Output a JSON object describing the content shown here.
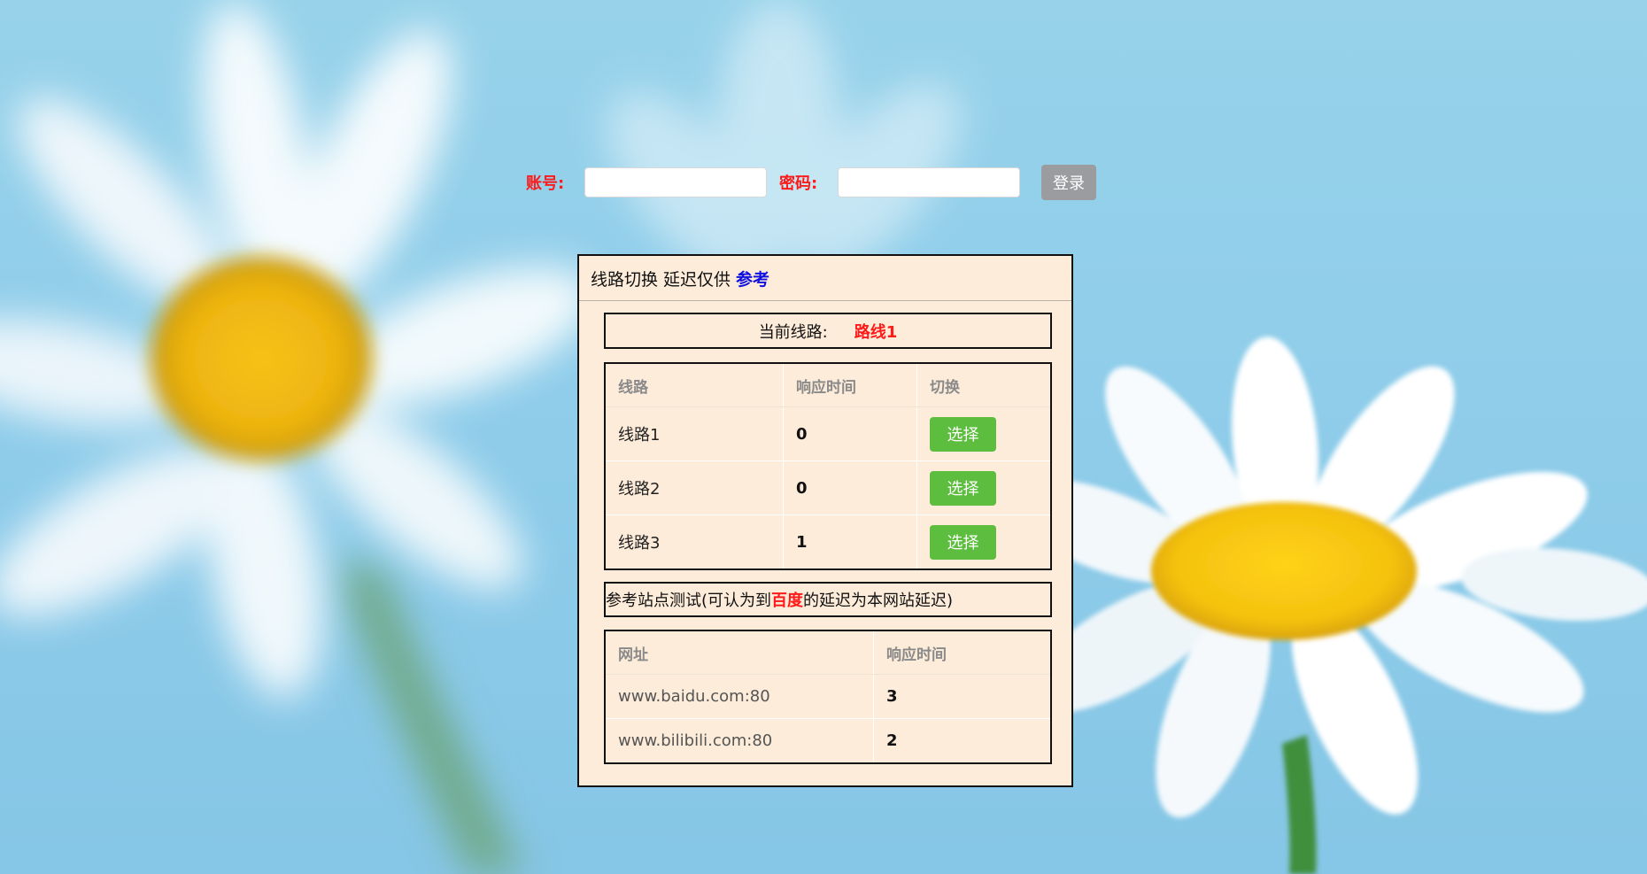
{
  "login": {
    "account_label": "账号:",
    "password_label": "密码:",
    "account_value": "",
    "password_value": "",
    "login_button": "登录"
  },
  "panel": {
    "title": "线路切换 延迟仅供",
    "title_highlight": "参考",
    "current_route_label": "当前线路:",
    "current_route_value": "路线1",
    "routes_table": {
      "headers": [
        "线路",
        "响应时间",
        "切换"
      ],
      "rows": [
        {
          "name": "线路1",
          "latency": "0",
          "action": "选择"
        },
        {
          "name": "线路2",
          "latency": "0",
          "action": "选择"
        },
        {
          "name": "线路3",
          "latency": "1",
          "action": "选择"
        }
      ]
    },
    "ref_test": {
      "prefix": "参考站点测试(可认为到",
      "highlight": "百度",
      "suffix": "的延迟为本网站延迟)"
    },
    "sites_table": {
      "headers": [
        "网址",
        "响应时间"
      ],
      "rows": [
        {
          "url": "www.baidu.com:80",
          "latency": "3"
        },
        {
          "url": "www.bilibili.com:80",
          "latency": "2"
        }
      ]
    }
  },
  "colors": {
    "accent_red": "#ff1a1a",
    "accent_blue": "#1010e0",
    "button_green": "#5cbd3e",
    "button_gray": "#9a9c9f",
    "panel_bg": "#fdecd9"
  }
}
